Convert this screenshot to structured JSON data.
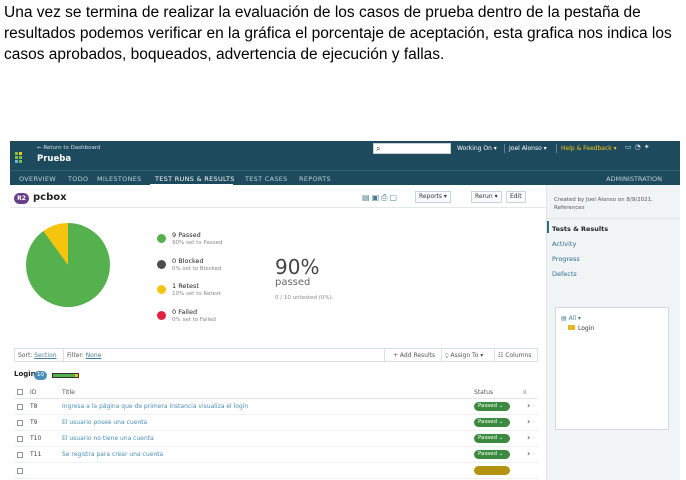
{
  "doc": {
    "paragraph": "Una vez se termina de realizar la evaluación de los casos de prueba dentro de la pestaña de resultados podemos verificar en la gráfica el porcentaje de aceptación, esta grafica nos indica los casos aprobados, boqueados, advertencia de ejecución y fallas."
  },
  "header": {
    "back_link": "← Return to Dashboard",
    "project": "Prueba",
    "working_on": "Working On ▾",
    "user": "Joel Alonso ▾",
    "help": "Help & Feedback ▾"
  },
  "nav": {
    "items": [
      "OVERVIEW",
      "TODO",
      "MILESTONES",
      "TEST RUNS & RESULTS",
      "TEST CASES",
      "REPORTS"
    ],
    "admin": "ADMINISTRATION"
  },
  "run": {
    "badge": "R2",
    "title": "pcbox",
    "reports_btn": "Reports ▾",
    "rerun_btn": "Rerun ▾",
    "edit_btn": "Edit"
  },
  "stats": {
    "passed": {
      "label": "9 Passed",
      "sub": "90% set to Passed",
      "color": "#55b04e"
    },
    "blocked": {
      "label": "0 Blocked",
      "sub": "0% set to Blocked",
      "color": "#4d4d4d"
    },
    "retest": {
      "label": "1 Retest",
      "sub": "10% set to Retest",
      "color": "#f6c40e"
    },
    "failed": {
      "label": "0 Failed",
      "sub": "0% set to Failed",
      "color": "#e0223c"
    },
    "percent": "90%",
    "percent_label": "passed",
    "untested": "0 / 10 untested (0%)."
  },
  "chart_data": {
    "type": "pie",
    "categories": [
      "Passed",
      "Blocked",
      "Retest",
      "Failed"
    ],
    "values": [
      9,
      0,
      1,
      0
    ]
  },
  "filter": {
    "sort_label": "Sort:",
    "sort_value": "Section",
    "filter_label": "Filter:",
    "filter_value": "None",
    "add_results": "+ Add Results",
    "assign_to": "Assign To ▾",
    "columns": "Columns"
  },
  "group": {
    "title": "Login",
    "count": "10"
  },
  "table": {
    "headers": {
      "id": "ID",
      "title": "Title",
      "status": "Status"
    },
    "rows": [
      {
        "id": "T8",
        "title": "Ingresa a la página que de primera instancia visualiza el login",
        "status": "Passed ⌄"
      },
      {
        "id": "T9",
        "title": "El usuario posee una cuenta",
        "status": "Passed ⌄"
      },
      {
        "id": "T10",
        "title": "El usuario no tiene una cuenta",
        "status": "Passed ⌄"
      },
      {
        "id": "T11",
        "title": "Se registra para crear una cuenta",
        "status": "Passed ⌄"
      }
    ]
  },
  "sidebar": {
    "created": "Created by Joel Alonso on 8/9/2021.",
    "references": "References",
    "links": [
      "Tests & Results",
      "Activity",
      "Progress",
      "Defects"
    ],
    "tree_all": "All ▾",
    "tree_node": "Login"
  }
}
